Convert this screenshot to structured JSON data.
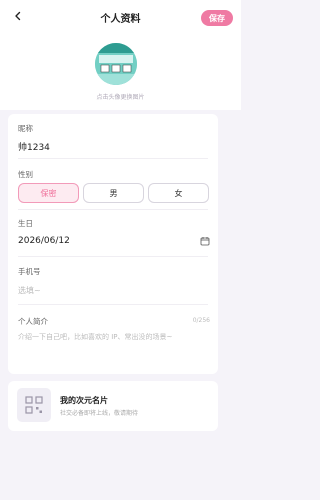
{
  "header": {
    "title": "个人资料",
    "save_label": "保存",
    "back_icon": "chevron-left-icon"
  },
  "avatar": {
    "hint": "点击头像更换图片"
  },
  "form": {
    "nickname": {
      "label": "昵称",
      "value": "帅1234"
    },
    "gender": {
      "label": "性别",
      "options": [
        "保密",
        "男",
        "女"
      ],
      "selected": "保密"
    },
    "birthday": {
      "label": "生日",
      "value": "2026/06/12",
      "icon": "calendar-icon"
    },
    "phone": {
      "label": "手机号",
      "placeholder": "选填~"
    },
    "bio": {
      "label": "个人简介",
      "placeholder": "介绍一下自己吧，比如喜欢的 IP、常出没的场景~",
      "counter": "0/256"
    }
  },
  "card": {
    "title": "我的次元名片",
    "subtitle": "社交必备即将上线，敬请期待",
    "icon": "qr-code-icon"
  },
  "colors": {
    "accent": "#ef7aa3",
    "background": "#f5f3f9",
    "avatar_bg": "#72cfc4"
  }
}
